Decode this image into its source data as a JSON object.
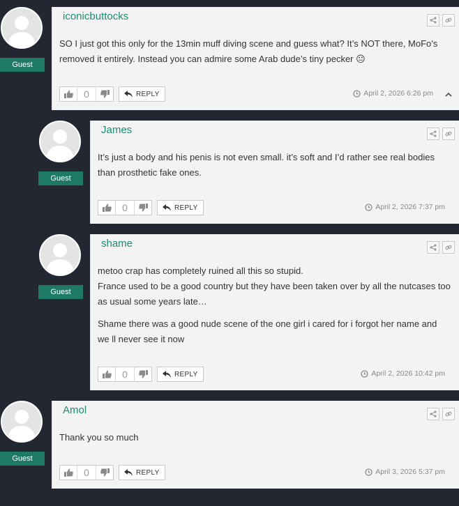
{
  "comments": [
    {
      "author": "iconicbuttocks",
      "badge": "Guest",
      "paragraphs": [
        "SO I just got this only for the 13min muff diving scene and guess what? It’s NOT there, MoFo’s removed it entirely. Instead you can admire some Arab dude’s tiny pecker 😐"
      ],
      "votes": "0",
      "reply_label": "REPLY",
      "date": "April 2, 2026 6:26 pm"
    },
    {
      "author": "James",
      "badge": "Guest",
      "paragraphs": [
        "It’s just a body and his penis is not even small. it’s soft and I’d rather see real bodies than prosthetic fake ones."
      ],
      "votes": "0",
      "reply_label": "REPLY",
      "date": "April 2, 2026 7:37 pm"
    },
    {
      "author": "shame",
      "badge": "Guest",
      "paragraphs": [
        "metoo crap has completely ruined all this so stupid.\nFrance used to be a good country but they have been taken over by all the nutcases too as usual some years late…",
        "Shame there was a good nude scene of the one girl i cared for i forgot her name and we ll never see it now"
      ],
      "votes": "0",
      "reply_label": "REPLY",
      "date": "April 2, 2026 10:42 pm"
    },
    {
      "author": "Amol",
      "badge": "Guest",
      "paragraphs": [
        "Thank you so much"
      ],
      "votes": "0",
      "reply_label": "REPLY",
      "date": "April 3, 2026 5:37 pm"
    }
  ],
  "icons": {
    "share": "share-icon",
    "link": "link-icon",
    "thumbs_up": "thumbs-up-icon",
    "thumbs_down": "thumbs-down-icon",
    "reply": "reply-icon",
    "clock": "clock-icon",
    "collapse": "chevron-up-icon"
  },
  "colors": {
    "background": "#232732",
    "card": "#f3f3f3",
    "author": "#1e8c72",
    "badge": "#1e7a66"
  }
}
